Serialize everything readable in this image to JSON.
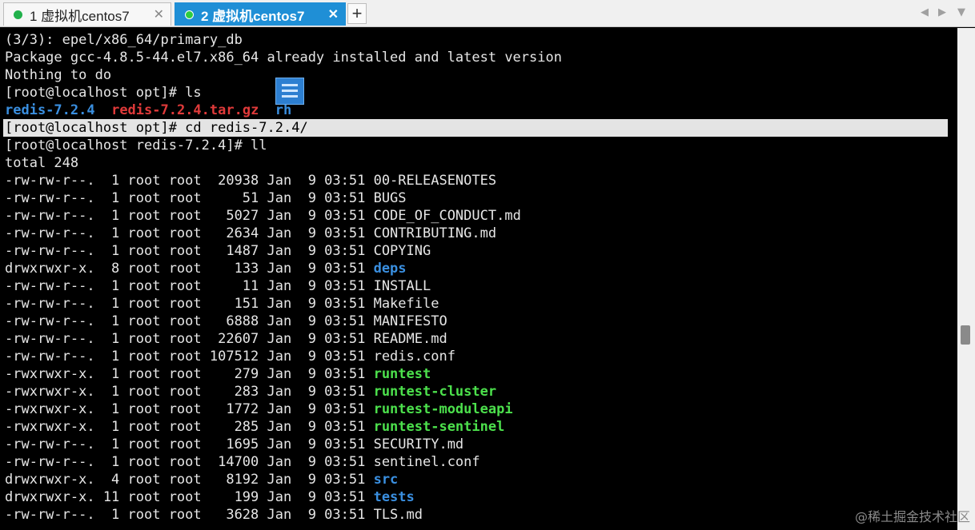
{
  "tabs": [
    {
      "label": "1 虚拟机centos7",
      "status_color": "#22b14c"
    },
    {
      "label": "2 虚拟机centos7",
      "status_color": "#2ecc40",
      "active": true
    }
  ],
  "tabbar": {
    "add_label": "+",
    "close_label": "✕",
    "prev_label": "◀",
    "next_label": "▶",
    "menu_label": "▼"
  },
  "terminal": {
    "pre_lines": [
      "(3/3): epel/x86_64/primary_db",
      "Package gcc-4.8.5-44.el7.x86_64 already installed and latest version",
      "Nothing to do",
      "[root@localhost opt]# ls"
    ],
    "ls_output": [
      {
        "name": "redis-7.2.4",
        "color": "blue"
      },
      {
        "name": "redis-7.2.4.tar.gz",
        "color": "red"
      },
      {
        "name": "rh",
        "color": "blue"
      }
    ],
    "selected_line": "[root@localhost opt]# cd redis-7.2.4/",
    "prompt_line": "[root@localhost redis-7.2.4]# ll",
    "total_line": "total 248",
    "files": [
      {
        "perm": "-rw-rw-r--.",
        "links": " 1",
        "size": "20938",
        "name": "00-RELEASENOTES",
        "color": ""
      },
      {
        "perm": "-rw-rw-r--.",
        "links": " 1",
        "size": "51",
        "name": "BUGS",
        "color": ""
      },
      {
        "perm": "-rw-rw-r--.",
        "links": " 1",
        "size": "5027",
        "name": "CODE_OF_CONDUCT.md",
        "color": ""
      },
      {
        "perm": "-rw-rw-r--.",
        "links": " 1",
        "size": "2634",
        "name": "CONTRIBUTING.md",
        "color": ""
      },
      {
        "perm": "-rw-rw-r--.",
        "links": " 1",
        "size": "1487",
        "name": "COPYING",
        "color": ""
      },
      {
        "perm": "drwxrwxr-x.",
        "links": " 8",
        "size": "133",
        "name": "deps",
        "color": "blue"
      },
      {
        "perm": "-rw-rw-r--.",
        "links": " 1",
        "size": "11",
        "name": "INSTALL",
        "color": ""
      },
      {
        "perm": "-rw-rw-r--.",
        "links": " 1",
        "size": "151",
        "name": "Makefile",
        "color": ""
      },
      {
        "perm": "-rw-rw-r--.",
        "links": " 1",
        "size": "6888",
        "name": "MANIFESTO",
        "color": ""
      },
      {
        "perm": "-rw-rw-r--.",
        "links": " 1",
        "size": "22607",
        "name": "README.md",
        "color": ""
      },
      {
        "perm": "-rw-rw-r--.",
        "links": " 1",
        "size": "107512",
        "name": "redis.conf",
        "color": ""
      },
      {
        "perm": "-rwxrwxr-x.",
        "links": " 1",
        "size": "279",
        "name": "runtest",
        "color": "green"
      },
      {
        "perm": "-rwxrwxr-x.",
        "links": " 1",
        "size": "283",
        "name": "runtest-cluster",
        "color": "green"
      },
      {
        "perm": "-rwxrwxr-x.",
        "links": " 1",
        "size": "1772",
        "name": "runtest-moduleapi",
        "color": "green"
      },
      {
        "perm": "-rwxrwxr-x.",
        "links": " 1",
        "size": "285",
        "name": "runtest-sentinel",
        "color": "green"
      },
      {
        "perm": "-rw-rw-r--.",
        "links": " 1",
        "size": "1695",
        "name": "SECURITY.md",
        "color": ""
      },
      {
        "perm": "-rw-rw-r--.",
        "links": " 1",
        "size": "14700",
        "name": "sentinel.conf",
        "color": ""
      },
      {
        "perm": "drwxrwxr-x.",
        "links": " 4",
        "size": "8192",
        "name": "src",
        "color": "blue"
      },
      {
        "perm": "drwxrwxr-x.",
        "links": "11",
        "size": "199",
        "name": "tests",
        "color": "blue"
      },
      {
        "perm": "-rw-rw-r--.",
        "links": " 1",
        "size": "3628",
        "name": "TLS.md",
        "color": ""
      }
    ],
    "owner": "root",
    "group": "root",
    "date": "Jan  9 03:51"
  },
  "watermark": "@稀土掘金技术社区",
  "icons": {
    "overlay": "list-window-icon"
  }
}
